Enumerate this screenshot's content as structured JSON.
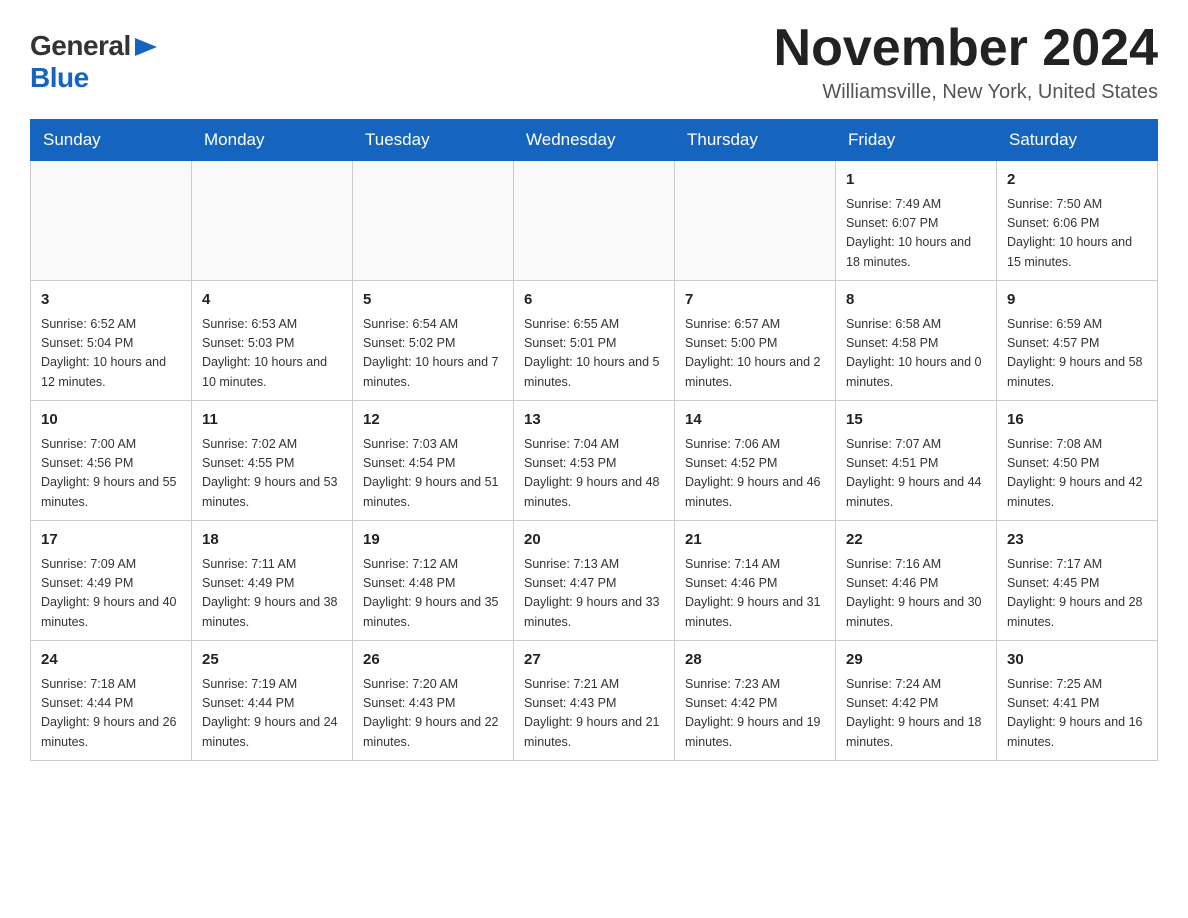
{
  "header": {
    "logo_general": "General",
    "logo_blue": "Blue",
    "month_title": "November 2024",
    "location": "Williamsville, New York, United States"
  },
  "weekdays": [
    "Sunday",
    "Monday",
    "Tuesday",
    "Wednesday",
    "Thursday",
    "Friday",
    "Saturday"
  ],
  "weeks": [
    [
      {
        "day": "",
        "sunrise": "",
        "sunset": "",
        "daylight": ""
      },
      {
        "day": "",
        "sunrise": "",
        "sunset": "",
        "daylight": ""
      },
      {
        "day": "",
        "sunrise": "",
        "sunset": "",
        "daylight": ""
      },
      {
        "day": "",
        "sunrise": "",
        "sunset": "",
        "daylight": ""
      },
      {
        "day": "",
        "sunrise": "",
        "sunset": "",
        "daylight": ""
      },
      {
        "day": "1",
        "sunrise": "Sunrise: 7:49 AM",
        "sunset": "Sunset: 6:07 PM",
        "daylight": "Daylight: 10 hours and 18 minutes."
      },
      {
        "day": "2",
        "sunrise": "Sunrise: 7:50 AM",
        "sunset": "Sunset: 6:06 PM",
        "daylight": "Daylight: 10 hours and 15 minutes."
      }
    ],
    [
      {
        "day": "3",
        "sunrise": "Sunrise: 6:52 AM",
        "sunset": "Sunset: 5:04 PM",
        "daylight": "Daylight: 10 hours and 12 minutes."
      },
      {
        "day": "4",
        "sunrise": "Sunrise: 6:53 AM",
        "sunset": "Sunset: 5:03 PM",
        "daylight": "Daylight: 10 hours and 10 minutes."
      },
      {
        "day": "5",
        "sunrise": "Sunrise: 6:54 AM",
        "sunset": "Sunset: 5:02 PM",
        "daylight": "Daylight: 10 hours and 7 minutes."
      },
      {
        "day": "6",
        "sunrise": "Sunrise: 6:55 AM",
        "sunset": "Sunset: 5:01 PM",
        "daylight": "Daylight: 10 hours and 5 minutes."
      },
      {
        "day": "7",
        "sunrise": "Sunrise: 6:57 AM",
        "sunset": "Sunset: 5:00 PM",
        "daylight": "Daylight: 10 hours and 2 minutes."
      },
      {
        "day": "8",
        "sunrise": "Sunrise: 6:58 AM",
        "sunset": "Sunset: 4:58 PM",
        "daylight": "Daylight: 10 hours and 0 minutes."
      },
      {
        "day": "9",
        "sunrise": "Sunrise: 6:59 AM",
        "sunset": "Sunset: 4:57 PM",
        "daylight": "Daylight: 9 hours and 58 minutes."
      }
    ],
    [
      {
        "day": "10",
        "sunrise": "Sunrise: 7:00 AM",
        "sunset": "Sunset: 4:56 PM",
        "daylight": "Daylight: 9 hours and 55 minutes."
      },
      {
        "day": "11",
        "sunrise": "Sunrise: 7:02 AM",
        "sunset": "Sunset: 4:55 PM",
        "daylight": "Daylight: 9 hours and 53 minutes."
      },
      {
        "day": "12",
        "sunrise": "Sunrise: 7:03 AM",
        "sunset": "Sunset: 4:54 PM",
        "daylight": "Daylight: 9 hours and 51 minutes."
      },
      {
        "day": "13",
        "sunrise": "Sunrise: 7:04 AM",
        "sunset": "Sunset: 4:53 PM",
        "daylight": "Daylight: 9 hours and 48 minutes."
      },
      {
        "day": "14",
        "sunrise": "Sunrise: 7:06 AM",
        "sunset": "Sunset: 4:52 PM",
        "daylight": "Daylight: 9 hours and 46 minutes."
      },
      {
        "day": "15",
        "sunrise": "Sunrise: 7:07 AM",
        "sunset": "Sunset: 4:51 PM",
        "daylight": "Daylight: 9 hours and 44 minutes."
      },
      {
        "day": "16",
        "sunrise": "Sunrise: 7:08 AM",
        "sunset": "Sunset: 4:50 PM",
        "daylight": "Daylight: 9 hours and 42 minutes."
      }
    ],
    [
      {
        "day": "17",
        "sunrise": "Sunrise: 7:09 AM",
        "sunset": "Sunset: 4:49 PM",
        "daylight": "Daylight: 9 hours and 40 minutes."
      },
      {
        "day": "18",
        "sunrise": "Sunrise: 7:11 AM",
        "sunset": "Sunset: 4:49 PM",
        "daylight": "Daylight: 9 hours and 38 minutes."
      },
      {
        "day": "19",
        "sunrise": "Sunrise: 7:12 AM",
        "sunset": "Sunset: 4:48 PM",
        "daylight": "Daylight: 9 hours and 35 minutes."
      },
      {
        "day": "20",
        "sunrise": "Sunrise: 7:13 AM",
        "sunset": "Sunset: 4:47 PM",
        "daylight": "Daylight: 9 hours and 33 minutes."
      },
      {
        "day": "21",
        "sunrise": "Sunrise: 7:14 AM",
        "sunset": "Sunset: 4:46 PM",
        "daylight": "Daylight: 9 hours and 31 minutes."
      },
      {
        "day": "22",
        "sunrise": "Sunrise: 7:16 AM",
        "sunset": "Sunset: 4:46 PM",
        "daylight": "Daylight: 9 hours and 30 minutes."
      },
      {
        "day": "23",
        "sunrise": "Sunrise: 7:17 AM",
        "sunset": "Sunset: 4:45 PM",
        "daylight": "Daylight: 9 hours and 28 minutes."
      }
    ],
    [
      {
        "day": "24",
        "sunrise": "Sunrise: 7:18 AM",
        "sunset": "Sunset: 4:44 PM",
        "daylight": "Daylight: 9 hours and 26 minutes."
      },
      {
        "day": "25",
        "sunrise": "Sunrise: 7:19 AM",
        "sunset": "Sunset: 4:44 PM",
        "daylight": "Daylight: 9 hours and 24 minutes."
      },
      {
        "day": "26",
        "sunrise": "Sunrise: 7:20 AM",
        "sunset": "Sunset: 4:43 PM",
        "daylight": "Daylight: 9 hours and 22 minutes."
      },
      {
        "day": "27",
        "sunrise": "Sunrise: 7:21 AM",
        "sunset": "Sunset: 4:43 PM",
        "daylight": "Daylight: 9 hours and 21 minutes."
      },
      {
        "day": "28",
        "sunrise": "Sunrise: 7:23 AM",
        "sunset": "Sunset: 4:42 PM",
        "daylight": "Daylight: 9 hours and 19 minutes."
      },
      {
        "day": "29",
        "sunrise": "Sunrise: 7:24 AM",
        "sunset": "Sunset: 4:42 PM",
        "daylight": "Daylight: 9 hours and 18 minutes."
      },
      {
        "day": "30",
        "sunrise": "Sunrise: 7:25 AM",
        "sunset": "Sunset: 4:41 PM",
        "daylight": "Daylight: 9 hours and 16 minutes."
      }
    ]
  ]
}
